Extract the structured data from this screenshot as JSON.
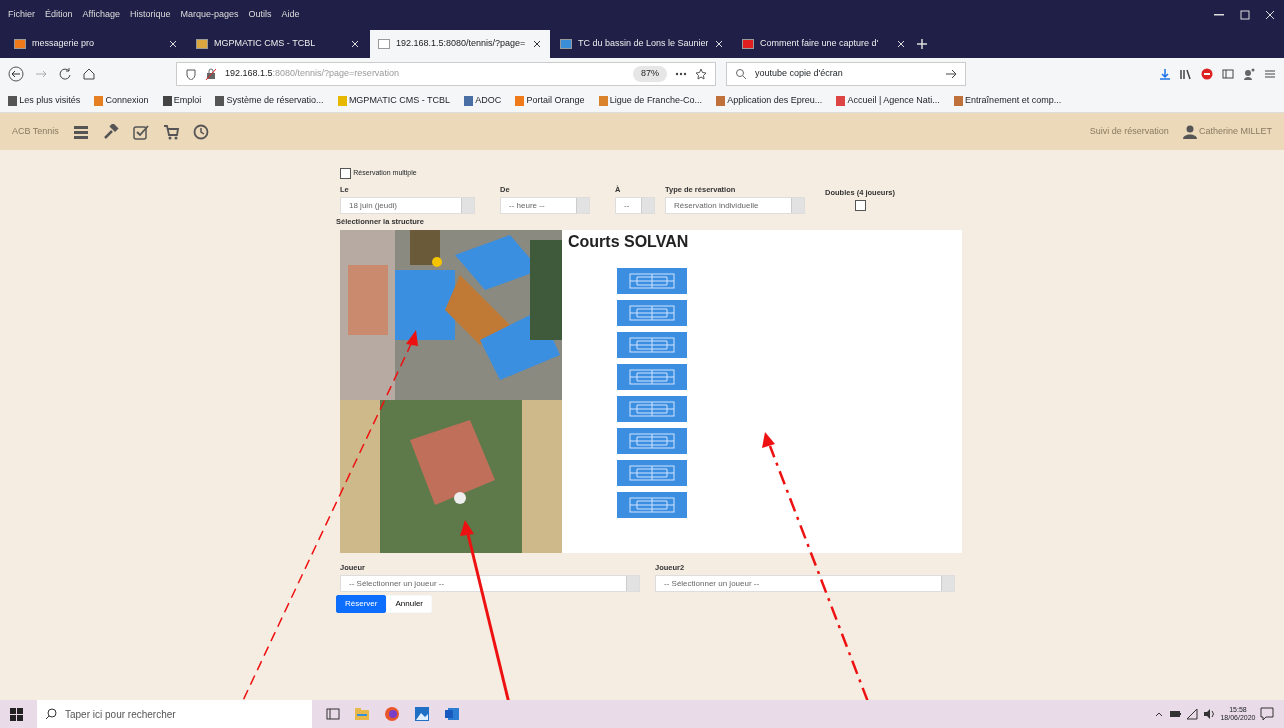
{
  "menu_bar": [
    "Fichier",
    "Édition",
    "Affichage",
    "Historique",
    "Marque-pages",
    "Outils",
    "Aide"
  ],
  "tabs": [
    {
      "title": "messagerie pro",
      "selected": false,
      "color": "#f07a1a"
    },
    {
      "title": "MGPMATIC CMS - TCBL",
      "selected": false,
      "color": "#d9a640"
    },
    {
      "title": "192.168.1.5:8080/tennis/?page=",
      "selected": true,
      "color": "#ffffff"
    },
    {
      "title": "TC du bassin de Lons le Saunier",
      "selected": false,
      "color": "#3a8ed8"
    },
    {
      "title": "Comment faire une capture d'",
      "selected": false,
      "color": "#e02020"
    }
  ],
  "toolbar": {
    "host": "192.168.1.5",
    "path": ":8080/tennis/?page=reservation",
    "zoom": "87%",
    "search": "youtube copie d'écran"
  },
  "bookmarks": [
    "Les plus visités",
    "Connexion",
    "Emploi",
    "Système de réservatio...",
    "MGPMATIC CMS - TCBL",
    "ADOC",
    "Portail Orange",
    "Ligue de Franche-Co...",
    "Application des Epreu...",
    "Accueil | Agence Nati...",
    "Entraînement et comp..."
  ],
  "app_nav": {
    "brand": "ACB Tennis",
    "link": "Suivi de réservation",
    "user": "Catherine MILLET"
  },
  "form": {
    "multiple": {
      "label": "Réservation multiple",
      "checked": false
    },
    "fields": [
      {
        "label": "Le",
        "value": "18 juin (jeudi)"
      },
      {
        "label": "De",
        "value": "-- heure --"
      },
      {
        "label": "À",
        "value": "--"
      },
      {
        "label": "Type de réservation",
        "value": "Réservation individuelle"
      }
    ],
    "doubles": {
      "label": "Doubles (4 joueurs)",
      "checked": false
    },
    "structure_label": "Sélectionner la structure"
  },
  "structure": {
    "title": "Courts SOLVAN",
    "courts": [
      {
        "kind": "court"
      },
      {
        "kind": "court"
      },
      {
        "kind": "court"
      },
      {
        "kind": "court"
      },
      {
        "kind": "court"
      },
      {
        "kind": "court"
      },
      {
        "kind": "court"
      },
      {
        "kind": "court"
      }
    ]
  },
  "players": [
    {
      "label": "Joueur",
      "value": "-- Sélectionner un joueur --"
    },
    {
      "label": "Joueur2",
      "value": "-- Sélectionner un joueur --"
    }
  ],
  "buttons": [
    {
      "label": "Réserver",
      "kind": "primary"
    },
    {
      "label": "Annuler",
      "kind": "secondary"
    }
  ],
  "taskbar": {
    "search_placeholder": "Taper ici pour rechercher",
    "time": "15:58",
    "date": "18/06/2020"
  }
}
